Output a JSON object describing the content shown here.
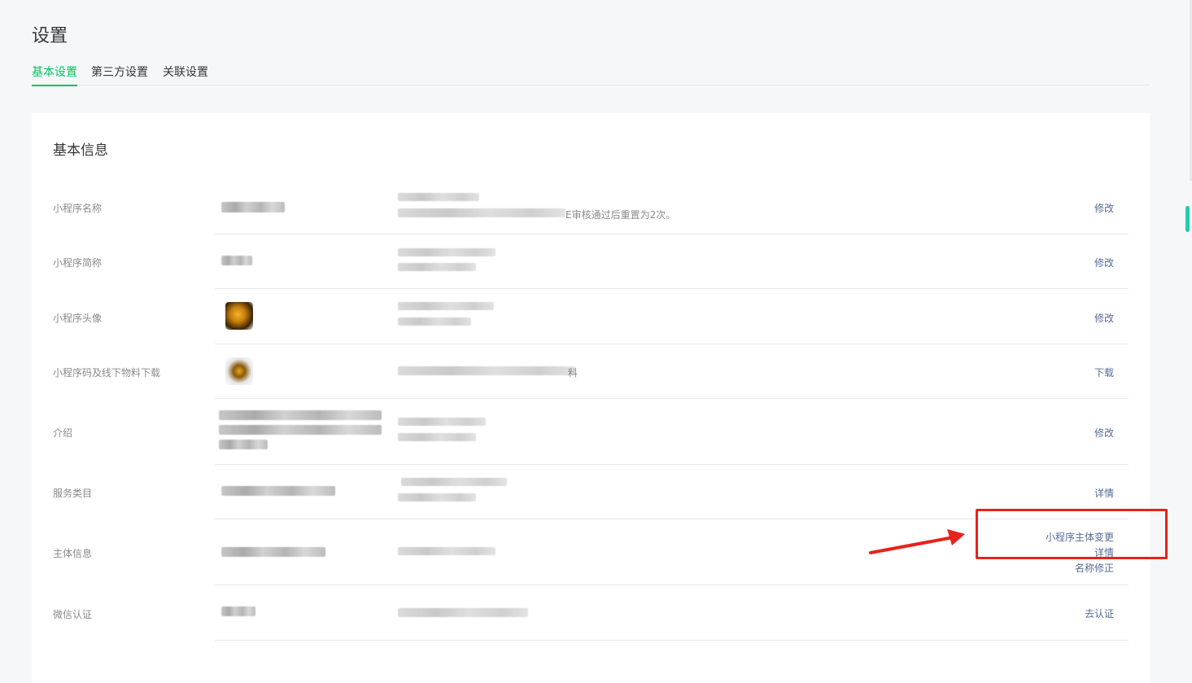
{
  "page": {
    "title": "设置"
  },
  "tabs": [
    {
      "label": "基本设置",
      "active": true
    },
    {
      "label": "第三方设置",
      "active": false
    },
    {
      "label": "关联设置",
      "active": false
    }
  ],
  "card": {
    "title": "基本信息",
    "rows": [
      {
        "label": "小程序名称",
        "desc_tail": "E审核通过后重置为2次。",
        "action": "修改"
      },
      {
        "label": "小程序简称",
        "action": "修改"
      },
      {
        "label": "小程序头像",
        "action": "修改"
      },
      {
        "label": "小程序码及线下物料下载",
        "desc_tail": "料",
        "action": "下载"
      },
      {
        "label": "介绍",
        "action": "修改"
      },
      {
        "label": "服务类目",
        "action": "详情"
      },
      {
        "label": "主体信息",
        "actions": [
          "小程序主体变更",
          "详情",
          "名称修正"
        ]
      },
      {
        "label": "微信认证",
        "action": "去认证"
      }
    ]
  },
  "colors": {
    "accent": "#07c160",
    "link": "#576b95",
    "annotation": "#e8221c"
  }
}
